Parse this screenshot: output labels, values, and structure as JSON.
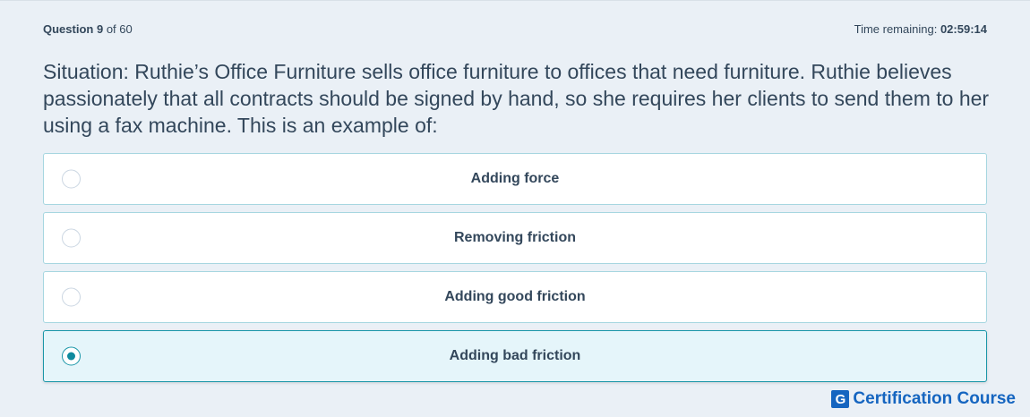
{
  "header": {
    "question_label": "Question",
    "question_number": "9",
    "question_of": "of 60",
    "time_label": "Time remaining:",
    "time_value": "02:59:14"
  },
  "question": {
    "text": "Situation: Ruthie’s Office Furniture sells office furniture to offices that need furniture. Ruthie believes passionately that all contracts should be signed by hand, so she requires her clients to send them to her using a fax machine. This is an example of:"
  },
  "options": [
    {
      "label": "Adding force",
      "selected": false
    },
    {
      "label": "Removing friction",
      "selected": false
    },
    {
      "label": "Adding good friction",
      "selected": false
    },
    {
      "label": "Adding bad friction",
      "selected": true
    }
  ],
  "brand": {
    "logo_letter": "G",
    "name": "Certification Course"
  },
  "colors": {
    "accent": "#0f8a9e",
    "brand": "#1565c0",
    "background": "#eaf0f6"
  }
}
